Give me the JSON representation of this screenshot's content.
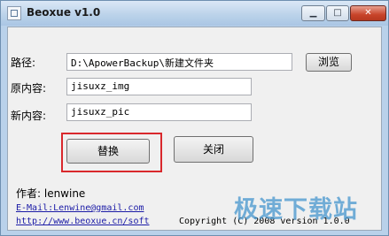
{
  "window": {
    "title": "Beoxue v1.0"
  },
  "form": {
    "path_label": "路径:",
    "path_value": "D:\\ApowerBackup\\新建文件夹",
    "browse_label": "浏览",
    "original_label": "原内容:",
    "original_value": "jisuxz_img",
    "new_label": "新内容:",
    "new_value": "jisuxz_pic"
  },
  "actions": {
    "replace_label": "替换",
    "close_label": "关闭"
  },
  "footer": {
    "author": "作者: lenwine",
    "email": "E-Mail:Lenwine@gmail.com",
    "website": "http://www.beoxue.cn/soft",
    "copyright": "Copyright (C) 2008 version 1.0.0"
  },
  "watermark": "极速下载站",
  "colors": {
    "highlight": "#d9282c",
    "link": "#1a1aa6",
    "titlebar": "#bcd3ea",
    "close_button": "#c8442a"
  }
}
